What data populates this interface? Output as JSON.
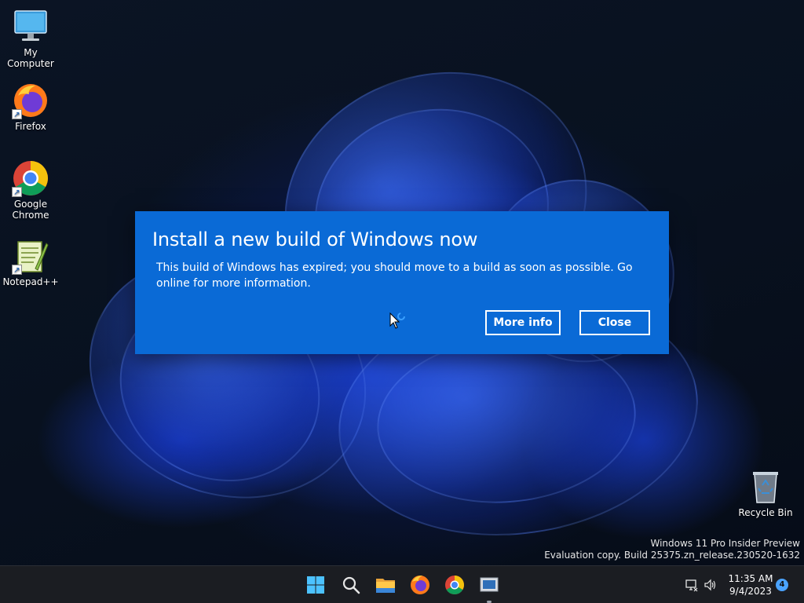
{
  "desktop": {
    "icons": [
      {
        "label": "My Computer",
        "icon": "monitor-icon"
      },
      {
        "label": "Firefox",
        "icon": "firefox-icon"
      },
      {
        "label": "Google Chrome",
        "icon": "chrome-icon"
      },
      {
        "label": "Notepad++",
        "icon": "notepad-plus-plus-icon"
      },
      {
        "label": "Recycle Bin",
        "icon": "recycle-bin-icon"
      }
    ]
  },
  "dialog": {
    "title": "Install a new build of Windows now",
    "message": "This build of Windows has expired; you should move to a build as soon as possible. Go online for more information.",
    "more_info_label": "More info",
    "close_label": "Close",
    "background_color": "#0a6ad6"
  },
  "watermark": {
    "line1": "Windows 11 Pro Insider Preview",
    "line2": "Evaluation copy. Build 25375.zn_release.230520-1632"
  },
  "taskbar": {
    "apps": [
      "start-icon",
      "search-icon",
      "file-explorer-icon",
      "firefox-icon",
      "chrome-icon",
      "app-window-icon"
    ],
    "clock": {
      "time": "11:35 AM",
      "date": "9/4/2023"
    },
    "notification_count": "4"
  }
}
